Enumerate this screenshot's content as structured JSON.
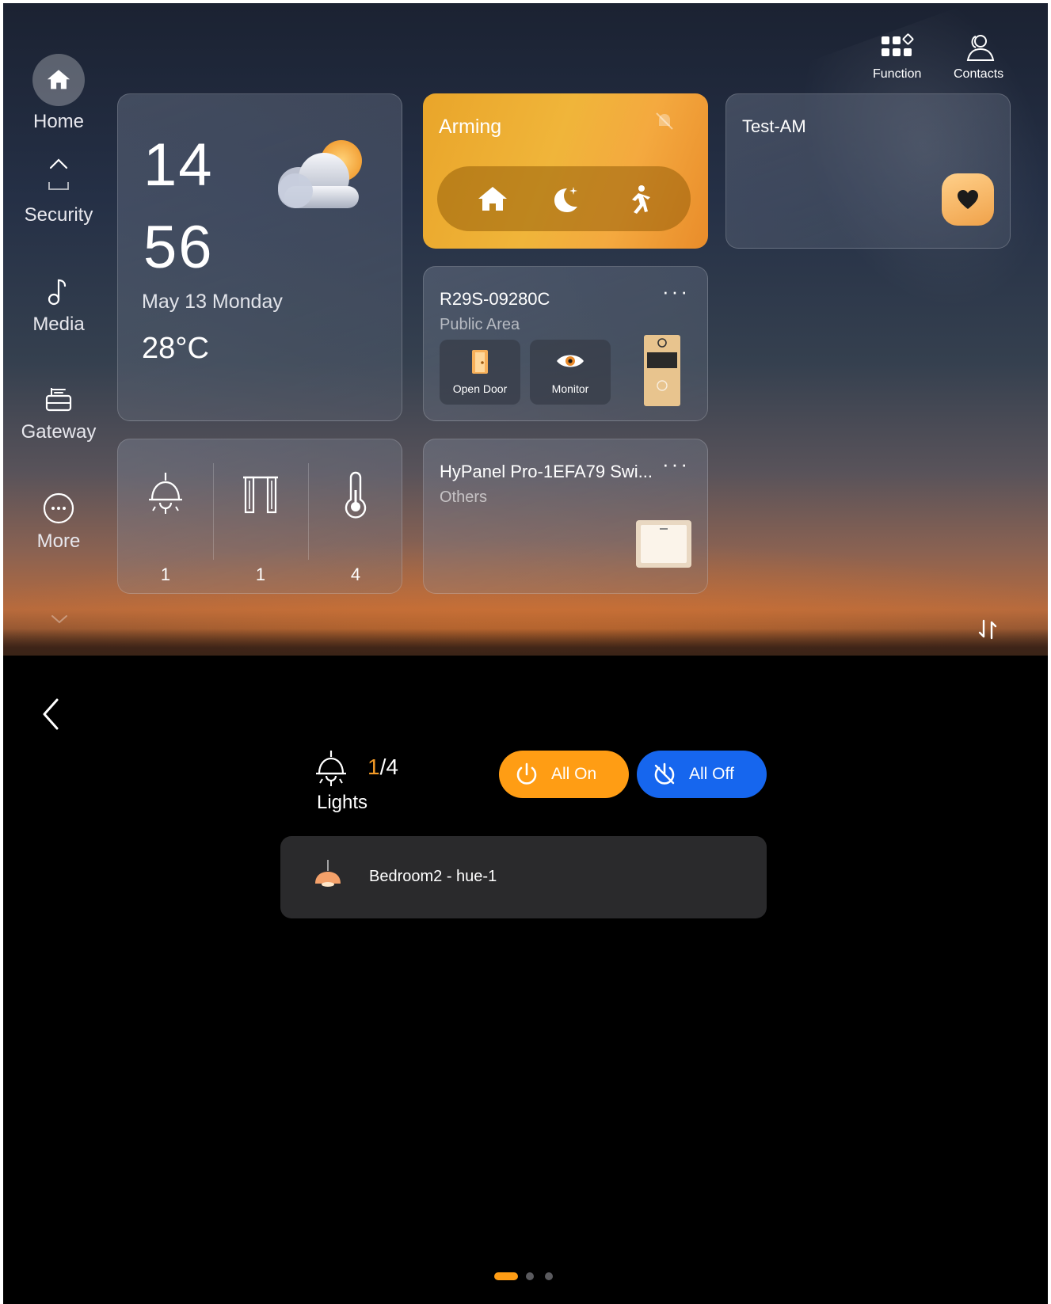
{
  "sidebar": {
    "items": [
      {
        "label": "Home",
        "icon": "home-icon"
      },
      {
        "label": "Security",
        "icon": "security-icon"
      },
      {
        "label": "Media",
        "icon": "music-note-icon"
      },
      {
        "label": "Gateway",
        "icon": "gateway-router-icon"
      },
      {
        "label": "More",
        "icon": "more-circle-icon"
      }
    ]
  },
  "header": {
    "function_label": "Function",
    "contacts_label": "Contacts"
  },
  "weather_card": {
    "hour": "14",
    "minute": "56",
    "date": "May 13  Monday",
    "temperature": "28°C",
    "weather_icon": "partly-cloudy-icon"
  },
  "arming_card": {
    "title": "Arming",
    "modes": [
      "home-mode-icon",
      "night-mode-icon",
      "away-mode-icon"
    ]
  },
  "test_card": {
    "title": "Test-AM"
  },
  "intercom_card": {
    "title": "R29S-09280C",
    "subtitle": "Public Area",
    "open_door_label": "Open Door",
    "monitor_label": "Monitor"
  },
  "summary_card": {
    "lights_count": "1",
    "curtains_count": "1",
    "sensors_count": "4"
  },
  "switch_card": {
    "title": "HyPanel Pro-1EFA79 Swi...",
    "subtitle": "Others"
  },
  "lights_panel": {
    "on_count": "1",
    "total_suffix": "/4",
    "label": "Lights",
    "all_on_label": "All On",
    "all_off_label": "All Off",
    "devices": [
      {
        "name": "Bedroom2 - hue-1"
      }
    ],
    "page_indicator": {
      "current": 1,
      "total": 3
    }
  },
  "colors": {
    "accent_orange": "#ff9d14",
    "accent_blue": "#1666ee",
    "arming_yellow": "#f0b53a"
  }
}
